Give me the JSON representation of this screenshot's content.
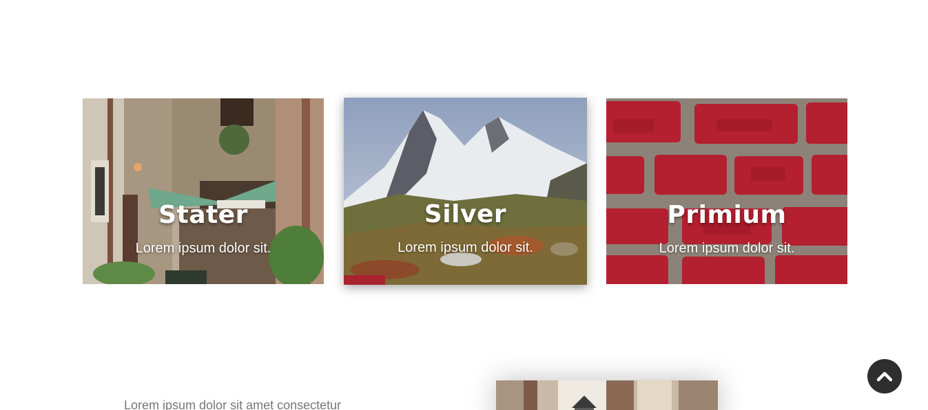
{
  "pricing_cards": [
    {
      "title": "Stater",
      "subtitle": "Lorem ipsum dolor sit."
    },
    {
      "title": "Silver",
      "subtitle": "Lorem ipsum dolor sit."
    },
    {
      "title": "Primium",
      "subtitle": "Lorem ipsum dolor sit."
    }
  ],
  "about": {
    "text": "Lorem ipsum dolor sit amet consectetur"
  },
  "icons": {
    "scroll_top": "chevron-up-icon"
  },
  "colors": {
    "scroll_top_bg": "#2e2e2e",
    "body_text": "#777777",
    "card_text": "#ffffff"
  }
}
